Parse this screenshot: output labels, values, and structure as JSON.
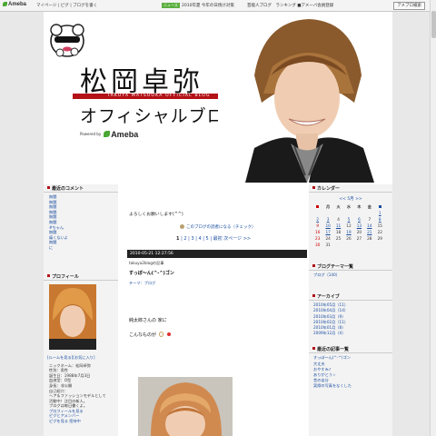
{
  "topbar": {
    "logo": "Ameba",
    "links": "マイページ | ピグ | ブログを書く",
    "news_flag": "ニュース",
    "news_text": "2010年夏 今年の日焼け対策",
    "promo": "芸能人ブログ　ランキング ■アメーバ会員登録",
    "search_label": "アメブロ検索"
  },
  "header": {
    "title": "松岡卓弥",
    "subtitle": "TAKUYA MATSUOKA OFFICIAL BLOG",
    "blog_subtitle": "オフィシャルブログ",
    "powered_by": "Powered by",
    "powered_brand": "Ameba"
  },
  "left": {
    "comments_title": "最近のコメント",
    "comments": [
      "無題",
      "無題",
      "無題",
      "無題",
      "無題",
      "無題",
      "#ちゃん",
      "無題",
      "痛くないよ",
      "無題",
      "に"
    ],
    "profile_title": "プロフィール",
    "profile_link": "[ルームを見る][お気に入り]",
    "profile_lines": [
      "ニックネーム：松岡卓弥",
      "性別：男性",
      "誕生日：1988年7月3日",
      "血液型：O型",
      "身長：非公開",
      "自己紹介：",
      "ヘア＆ファッションモデルとして",
      "活動中！注目の新人。",
      "ブログは毎日書くよ。",
      "プロフィールを見る",
      "ピグとアメンバー",
      "ピグを見る 招待中"
    ]
  },
  "center": {
    "greeting": "よろしくお願いします(^^)",
    "theme_note": "このブログの読者になる（チェック）",
    "pager": {
      "pages": [
        "1",
        "2",
        "3",
        "4",
        "5"
      ],
      "last": "最初",
      "next": "次ページ >>"
    },
    "entry_date": "2010-05-21 12:27:56",
    "entry_meta": "takuya2blogの記事",
    "entry_title": "すっぽ〜ん(^-^)ゴン",
    "entry_theme": "テーマ：ブログ",
    "line1": "純太郎さんの 家に",
    "line2": "こんなものが"
  },
  "right": {
    "calendar_title": "カレンダー",
    "calendar_nav": "<< 5月 >>",
    "weekdays": [
      "日",
      "月",
      "火",
      "水",
      "木",
      "金",
      "土"
    ],
    "weeks": [
      [
        "",
        "",
        "",
        "",
        "",
        "",
        "1"
      ],
      [
        "2",
        "3",
        "4",
        "5",
        "6",
        "7",
        "8"
      ],
      [
        "9",
        "10",
        "11",
        "12",
        "13",
        "14",
        "15"
      ],
      [
        "16",
        "17",
        "18",
        "19",
        "20",
        "21",
        "22"
      ],
      [
        "23",
        "24",
        "25",
        "26",
        "27",
        "28",
        "29"
      ],
      [
        "30",
        "31",
        "",
        "",
        "",
        "",
        ""
      ]
    ],
    "themes_title": "ブログテーマ一覧",
    "themes_link": "ブログ（140）",
    "archive_title": "アーカイブ",
    "archive": [
      "2010年05月（11）",
      "2010年04月（14）",
      "2010年03月（9）",
      "2010年02月（11）",
      "2010年01月（8）",
      "2009年12月（4）"
    ],
    "recent_title": "最近の記事一覧",
    "recent": [
      "すっぽ〜ん(^-^)ゴン",
      "大丈夫",
      "おやすみ♪",
      "ありがとう☆",
      "昔の自分",
      "実際の写真をなくした"
    ]
  },
  "colors": {
    "accent": "#b31217",
    "link": "#1a4ea0",
    "header_bar": "#222222"
  }
}
